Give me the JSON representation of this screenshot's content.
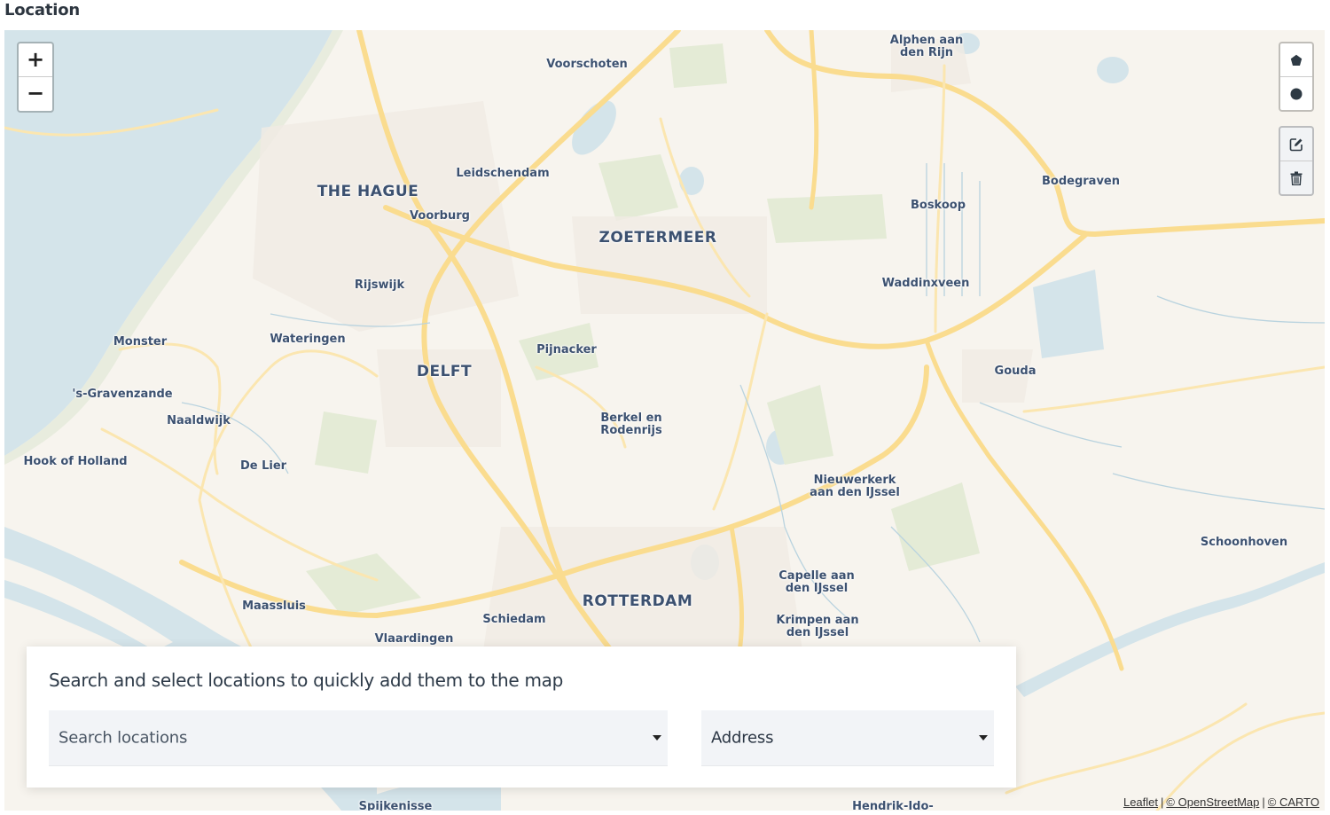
{
  "section": {
    "title": "Location"
  },
  "map": {
    "zoom_in_label": "+",
    "zoom_out_label": "−",
    "draw_tools": [
      {
        "name": "draw-polygon",
        "icon": "polygon-icon"
      },
      {
        "name": "draw-circle",
        "icon": "circle-icon"
      }
    ],
    "edit_tools": [
      {
        "name": "edit-layers",
        "icon": "edit-icon"
      },
      {
        "name": "delete-layers",
        "icon": "trash-icon"
      }
    ],
    "places": [
      {
        "label": "THE HAGUE",
        "kind": "city"
      },
      {
        "label": "ZOETERMEER",
        "kind": "city"
      },
      {
        "label": "DELFT",
        "kind": "city"
      },
      {
        "label": "ROTTERDAM",
        "kind": "city"
      },
      {
        "label": "Voorschoten"
      },
      {
        "label": "Leidschendam"
      },
      {
        "label": "Voorburg"
      },
      {
        "label": "Rijswijk"
      },
      {
        "label": "Wateringen"
      },
      {
        "label": "Monster"
      },
      {
        "label": "'s-Gravenzande"
      },
      {
        "label": "Naaldwijk"
      },
      {
        "label": "Hook of Holland"
      },
      {
        "label": "De Lier"
      },
      {
        "label": "Pijnacker"
      },
      {
        "label": "Berkel en",
        "line2": "Rodenrijs"
      },
      {
        "label": "Alphen aan",
        "line2": "den Rijn"
      },
      {
        "label": "Bodegraven"
      },
      {
        "label": "Boskoop"
      },
      {
        "label": "Waddinxveen"
      },
      {
        "label": "Gouda"
      },
      {
        "label": "Nieuwerkerk",
        "line2": "aan den IJssel"
      },
      {
        "label": "Capelle aan",
        "line2": "den IJssel"
      },
      {
        "label": "Krimpen aan",
        "line2": "den IJssel"
      },
      {
        "label": "Schoonhoven"
      },
      {
        "label": "Maassluis"
      },
      {
        "label": "Schiedam"
      },
      {
        "label": "Vlaardingen"
      },
      {
        "label": "Spijkenisse"
      },
      {
        "label": "Hendrik-Ido-"
      }
    ],
    "attribution": {
      "leaflet": "Leaflet",
      "osm": "© OpenStreetMap",
      "carto": "© CARTO",
      "separator": "|"
    },
    "colors": {
      "land": "#f7f4ee",
      "water": "#d4e4ea",
      "road": "#fadc8f",
      "park": "#e4ebd6",
      "label": "#3c5170"
    }
  },
  "search_panel": {
    "hint": "Search and select locations to quickly add them to the map",
    "location_select": {
      "placeholder": "Search locations"
    },
    "type_select": {
      "value": "Address"
    }
  }
}
